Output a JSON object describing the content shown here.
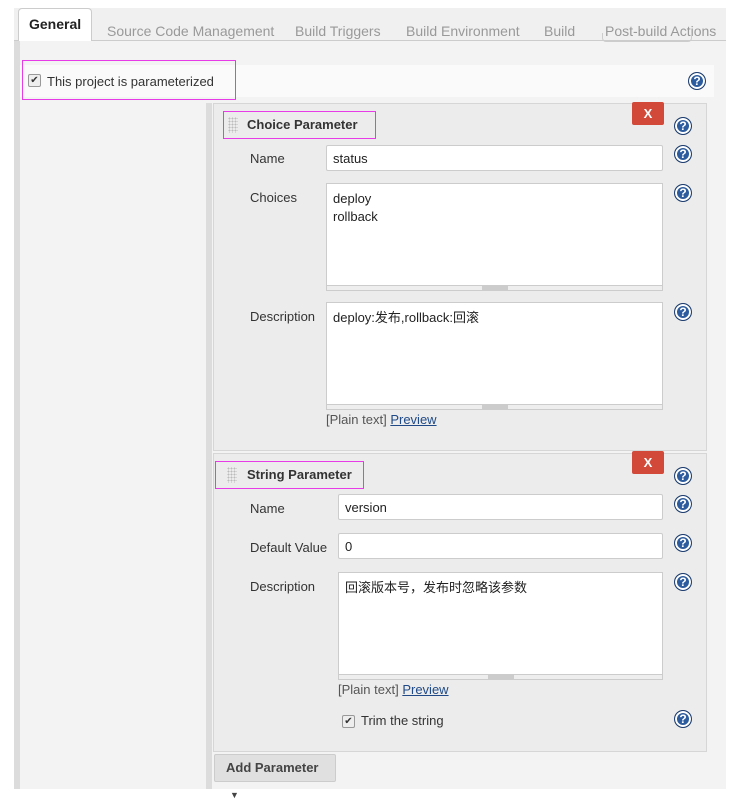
{
  "tabs": [
    "General",
    "Source Code Management",
    "Build Triggers",
    "Build Environment",
    "Build",
    "Post-build Actions"
  ],
  "parameterized": {
    "label": "This project is parameterized",
    "checked": true
  },
  "choice": {
    "title": "Choice Parameter",
    "remove": "X",
    "name_label": "Name",
    "name_value": "status",
    "choices_label": "Choices",
    "choices_value": "deploy\nrollback",
    "desc_label": "Description",
    "desc_value": "deploy:发布,rollback:回滚",
    "plain": "[Plain text]",
    "preview": "Preview"
  },
  "string": {
    "title": "String Parameter",
    "remove": "X",
    "name_label": "Name",
    "name_value": "version",
    "default_label": "Default Value",
    "default_value": "0",
    "desc_label": "Description",
    "desc_value": "回滚版本号，发布时忽略该参数",
    "plain": "[Plain text]",
    "preview": "Preview",
    "trim_label": "Trim the string",
    "trim_checked": true
  },
  "add_parameter": "Add Parameter",
  "help": "?"
}
